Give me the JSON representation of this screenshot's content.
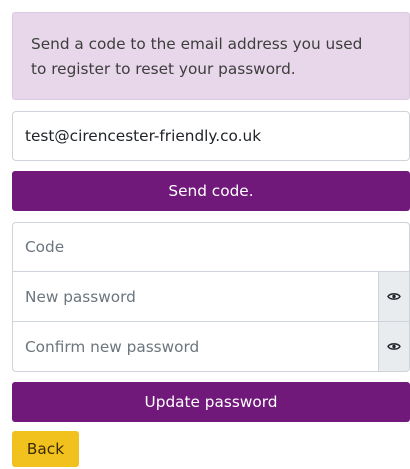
{
  "info": {
    "line1": "Send a code to the email address you used",
    "line2": "to register to reset your password."
  },
  "email": {
    "value": "test@cirencester-friendly.co.uk"
  },
  "send_button": {
    "label": "Send code."
  },
  "code": {
    "placeholder": "Code"
  },
  "new_password": {
    "placeholder": "New password",
    "toggle_icon": "eye-icon"
  },
  "confirm_password": {
    "placeholder": "Confirm new password",
    "toggle_icon": "eye-icon"
  },
  "update_button": {
    "label": "Update password"
  },
  "back_button": {
    "label": "Back"
  },
  "colors": {
    "accent": "#71197b",
    "info_bg": "#e8d7ea",
    "back_bg": "#f1c21d"
  }
}
